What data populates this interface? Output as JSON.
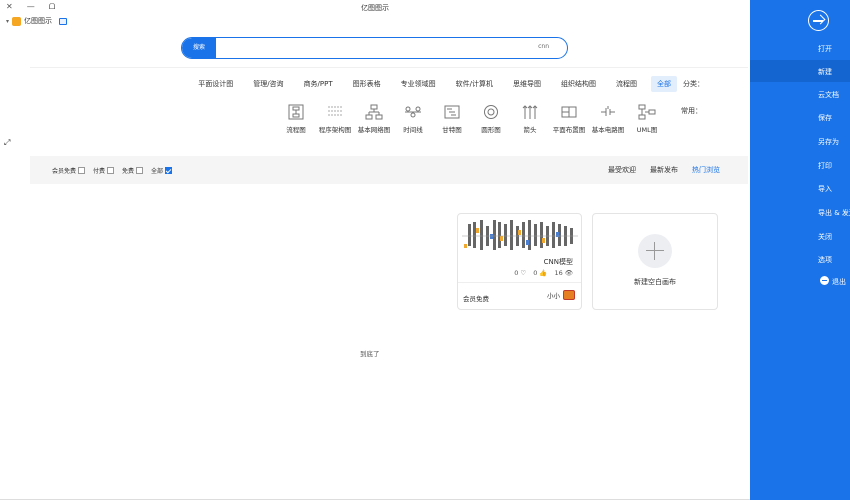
{
  "window": {
    "title": "亿图图示",
    "close": "✕",
    "minimize": "—",
    "restore": "ᗝ"
  },
  "brand": {
    "name": "亿图图示"
  },
  "search": {
    "button": "搜索",
    "value": "cnn"
  },
  "categories": {
    "label": "分类：",
    "items": [
      "全部",
      "流程图",
      "组织结构图",
      "思维导图",
      "软件/计算机",
      "专业领域图",
      "图形表格",
      "商务/PPT",
      "管理/咨询",
      "平面设计图"
    ],
    "active_index": 0
  },
  "common": {
    "label": "常用：",
    "items": [
      "UML图",
      "基本电路图",
      "平面布置图",
      "箭头",
      "圆形图",
      "甘特图",
      "时间线",
      "基本网络图",
      "程序架构图",
      "流程图"
    ]
  },
  "sort_tabs": {
    "items": [
      "热门浏览",
      "最新发布",
      "最受欢迎"
    ],
    "active_index": 0
  },
  "filters": {
    "items": [
      {
        "label": "全部",
        "checked": true
      },
      {
        "label": "免费",
        "checked": false
      },
      {
        "label": "付费",
        "checked": false
      },
      {
        "label": "会员免费",
        "checked": false
      }
    ]
  },
  "new_card": {
    "caption": "新建空白画布"
  },
  "template_card": {
    "name": "CNN模型",
    "views": "16",
    "likes": "0",
    "favorites": "0",
    "author": "小小",
    "price": "会员免费"
  },
  "end_text": "到底了",
  "sidebar": {
    "items": [
      {
        "label": "打开",
        "active": false
      },
      {
        "label": "新建",
        "active": true
      },
      {
        "label": "云文档",
        "active": false
      },
      {
        "label": "保存",
        "active": false
      },
      {
        "label": "另存为",
        "active": false
      },
      {
        "label": "打印",
        "active": false
      },
      {
        "label": "导入",
        "active": false
      },
      {
        "label": "导出 & 发送",
        "active": false
      },
      {
        "label": "关闭",
        "active": false
      },
      {
        "label": "选项",
        "active": false
      },
      {
        "label": "退出",
        "active": false
      }
    ]
  },
  "colors": {
    "accent": "#1a73e8",
    "sidebar": "#1a73e8",
    "sidebar_active": "#1565d0",
    "filter_bg": "#f5f5f5"
  }
}
